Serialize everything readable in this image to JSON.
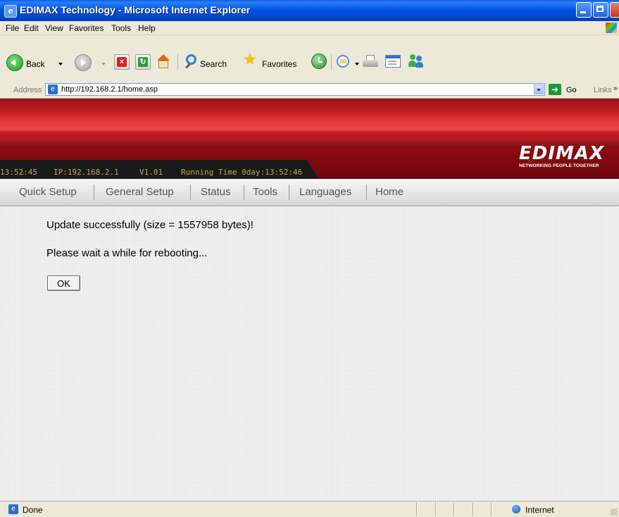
{
  "window": {
    "title": "EDIMAX Technology - Microsoft Internet Explorer"
  },
  "menu": [
    "File",
    "Edit",
    "View",
    "Favorites",
    "Tools",
    "Help"
  ],
  "toolbar": {
    "back_label": "Back",
    "search_label": "Search",
    "favorites_label": "Favorites"
  },
  "address": {
    "label": "Address",
    "url": "http://192.168.2.1/home.asp",
    "go_label": "Go",
    "links_label": "Links"
  },
  "router": {
    "time": "13:52:45",
    "ip": "IP:192.168.2.1",
    "version": "V1.01",
    "running_time": "Running Time 0day:13:52:46",
    "logo": "EDIMAX",
    "tagline": "NETWORKING PEOPLE TOGETHER",
    "nav": [
      "Quick Setup",
      "General Setup",
      "Status",
      "Tools",
      "Languages",
      "Home"
    ]
  },
  "content": {
    "message1": "Update successfully (size = 1557958 bytes)!",
    "message2": "Please wait a while for rebooting...",
    "ok_label": "OK"
  },
  "statusbar": {
    "status": "Done",
    "zone": "Internet"
  },
  "colors": {
    "titlebar": "#0054e3",
    "banner_red": "#c42226",
    "status_text": "#c8a640",
    "chrome_bg": "#ece9d8"
  }
}
